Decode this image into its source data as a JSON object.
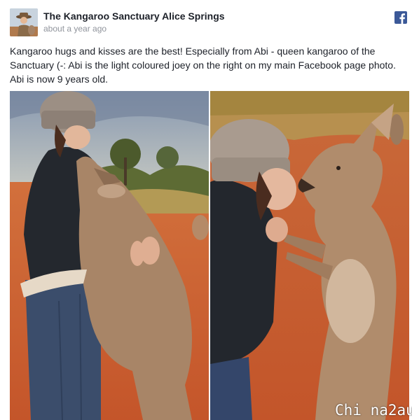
{
  "post": {
    "page_name": "The Kangaroo Sanctuary Alice Springs",
    "timestamp": "about a year ago",
    "caption": "Kangaroo hugs and kisses are the best! Especially from Abi - queen kangaroo of the Sanctuary (-: Abi is the light coloured joey on the right on my main Facebook page photo. Abi is now 9 years old.",
    "network_icon": "facebook-icon",
    "avatar_icon": "page-avatar"
  },
  "photos": [
    {
      "name": "hug-photo",
      "description_icon": "woman-hugging-kangaroo"
    },
    {
      "name": "kiss-photo",
      "description_icon": "woman-kissing-kangaroo"
    }
  ],
  "watermark": "Chi na2au",
  "colors": {
    "facebook_blue": "#3b5998",
    "name_text": "#1d2129",
    "meta_text": "#90949c",
    "red_earth": "#c75a2c"
  }
}
